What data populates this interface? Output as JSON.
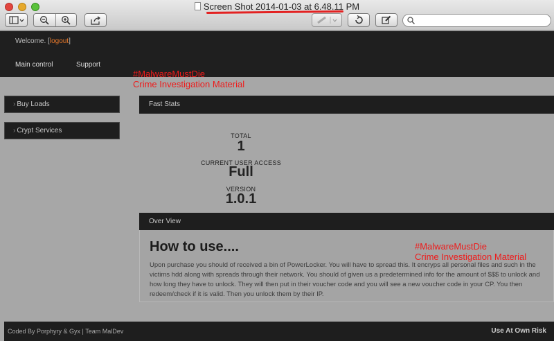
{
  "window": {
    "title": "Screen Shot 2014-01-03 at 6.48.11 PM"
  },
  "toolbar": {
    "sidebar_icon": "sidebar-icon",
    "zoom_out_icon": "zoom-out-icon",
    "zoom_in_icon": "zoom-in-icon",
    "share_icon": "share-icon",
    "annotate_icon": "annotate-icon",
    "rotate_icon": "rotate-icon",
    "edit_icon": "edit-icon",
    "search_icon": "search-icon",
    "search_placeholder": ""
  },
  "header": {
    "welcome_text": "Welcome.",
    "logout_label": "logout",
    "nav": [
      "Main control",
      "Support"
    ]
  },
  "watermark": {
    "tag": "#MalwareMustDie",
    "caption": "Crime Investigation Material"
  },
  "sidebar": {
    "items": [
      "Buy Loads",
      "Crypt Services"
    ]
  },
  "fast_stats": {
    "title": "Fast Stats",
    "total_label": "TOTAL",
    "total_value": "1",
    "access_label": "CURRENT USER ACCESS",
    "access_value": "Full",
    "version_label": "VERSION",
    "version_value": "1.0.1"
  },
  "overview": {
    "title": "Over View",
    "heading": "How to use....",
    "description": "Upon purchase you should of received a bin of PowerLocker. You will have to spread this. It encryps all personal files and such in the victims hdd along with spreads through their network. You should of given us a predetermined info for the amount of $$$ to unlock and how long they have to unlock. They will then put in their voucher code and you will see a new voucher code in your CP. You then redeem/check if it is valid. Then you unlock them by their IP."
  },
  "footer": {
    "credits": "Coded By Porphyry & Gyx | Team MalDev",
    "warning": "Use At Own Risk"
  },
  "colors": {
    "page_bg": "#a7a7a7",
    "bar_bg": "#1e1e1e",
    "link_orange": "#e8792b",
    "watermark_red": "#ee1b1b"
  }
}
